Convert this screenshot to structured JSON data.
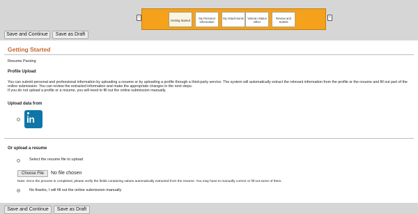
{
  "wizard": {
    "steps": [
      {
        "label": "Getting Started"
      },
      {
        "label": "My Personal Information"
      },
      {
        "label": "My Attachments"
      },
      {
        "label": "Veteran Status Other"
      },
      {
        "label": "Review and Submit"
      }
    ],
    "prev_icon": "chevron-left-icon",
    "next_icon": "chevron-right-icon"
  },
  "toolbar": {
    "save_continue_label": "Save and Continue",
    "save_draft_label": "Save as Draft"
  },
  "page": {
    "title": "Getting Started",
    "section_label": "Resume Parsing",
    "profile_upload_heading": "Profile Upload",
    "profile_upload_text": "You can submit personal and professional information by uploading a resume or by uploading a profile through a third-party service. The system will automatically extract the relevant information from the profile or the resume and fill out part of the online submission. You can review the extracted information and make the appropriate changes in the next steps.",
    "profile_upload_note": "If you do not upload a profile or a resume, you will need to fill out the online submission manually.",
    "upload_from_heading": "Upload data from",
    "linkedin_logo_text": "in",
    "or_upload_heading": "Or upload a resume",
    "select_resume_label": "Select the resume file to upload",
    "choose_file_label": "Choose File",
    "no_file_text": "No file chosen",
    "note_text": "Note: Once the process is completed, please verify the fields containing values automatically extracted from the resume. You may have to manually correct or fill out some of them.",
    "manual_option_label": "No thanks, I will fill out the online submission manually"
  }
}
